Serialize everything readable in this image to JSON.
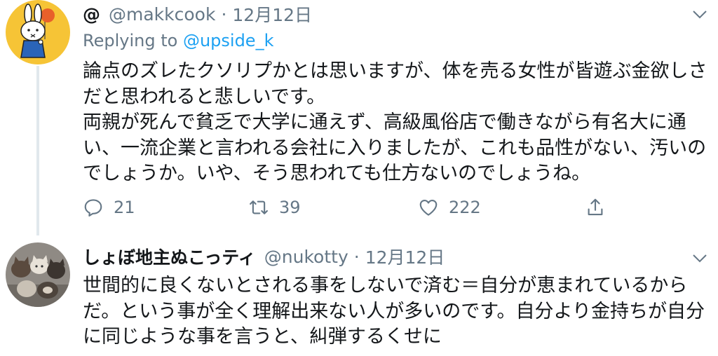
{
  "tweets": [
    {
      "display_name": "@",
      "handle": "@makkcook",
      "separator": "·",
      "date": "12月12日",
      "replying_prefix": "Replying to",
      "replying_to": "@upside_k",
      "lines": [
        "論点のズレたクソリプかとは思いますが、体を売る女性が皆遊ぶ金欲しさ",
        "だと思われると悲しいです。",
        "両親が死んで貧乏で大学に通えず、高級風俗店で働きながら有名大に通",
        "い、一流企業と言われる会社に入りましたが、これも品性がない、汚いの",
        "でしょうか。いや、そう思われても仕方ないのでしょうね。"
      ],
      "replies": "21",
      "retweets": "39",
      "likes": "222",
      "avatar_icon": "miffy-balloon-avatar"
    },
    {
      "display_name": "しょぼ地主ぬこっティ",
      "handle": "@nukotty",
      "separator": "·",
      "date": "12月12日",
      "lines": [
        "世間的に良くないとされる事をしないで済む＝自分が恵まれているから",
        "だ。という事が全く理解出来ない人が多いのです。自分より金持ちが自分",
        "に同じような事を言うと、糾弾するくせに"
      ],
      "avatar_icon": "kittens-photo-avatar"
    }
  ],
  "icons": {
    "reply": "reply-icon",
    "retweet": "retweet-icon",
    "like": "heart-icon",
    "share": "share-icon",
    "more": "chevron-down-icon"
  },
  "colors": {
    "text": "#14171a",
    "secondary": "#657786",
    "link": "#1da1f2",
    "thread_line": "#e1e8ed"
  }
}
